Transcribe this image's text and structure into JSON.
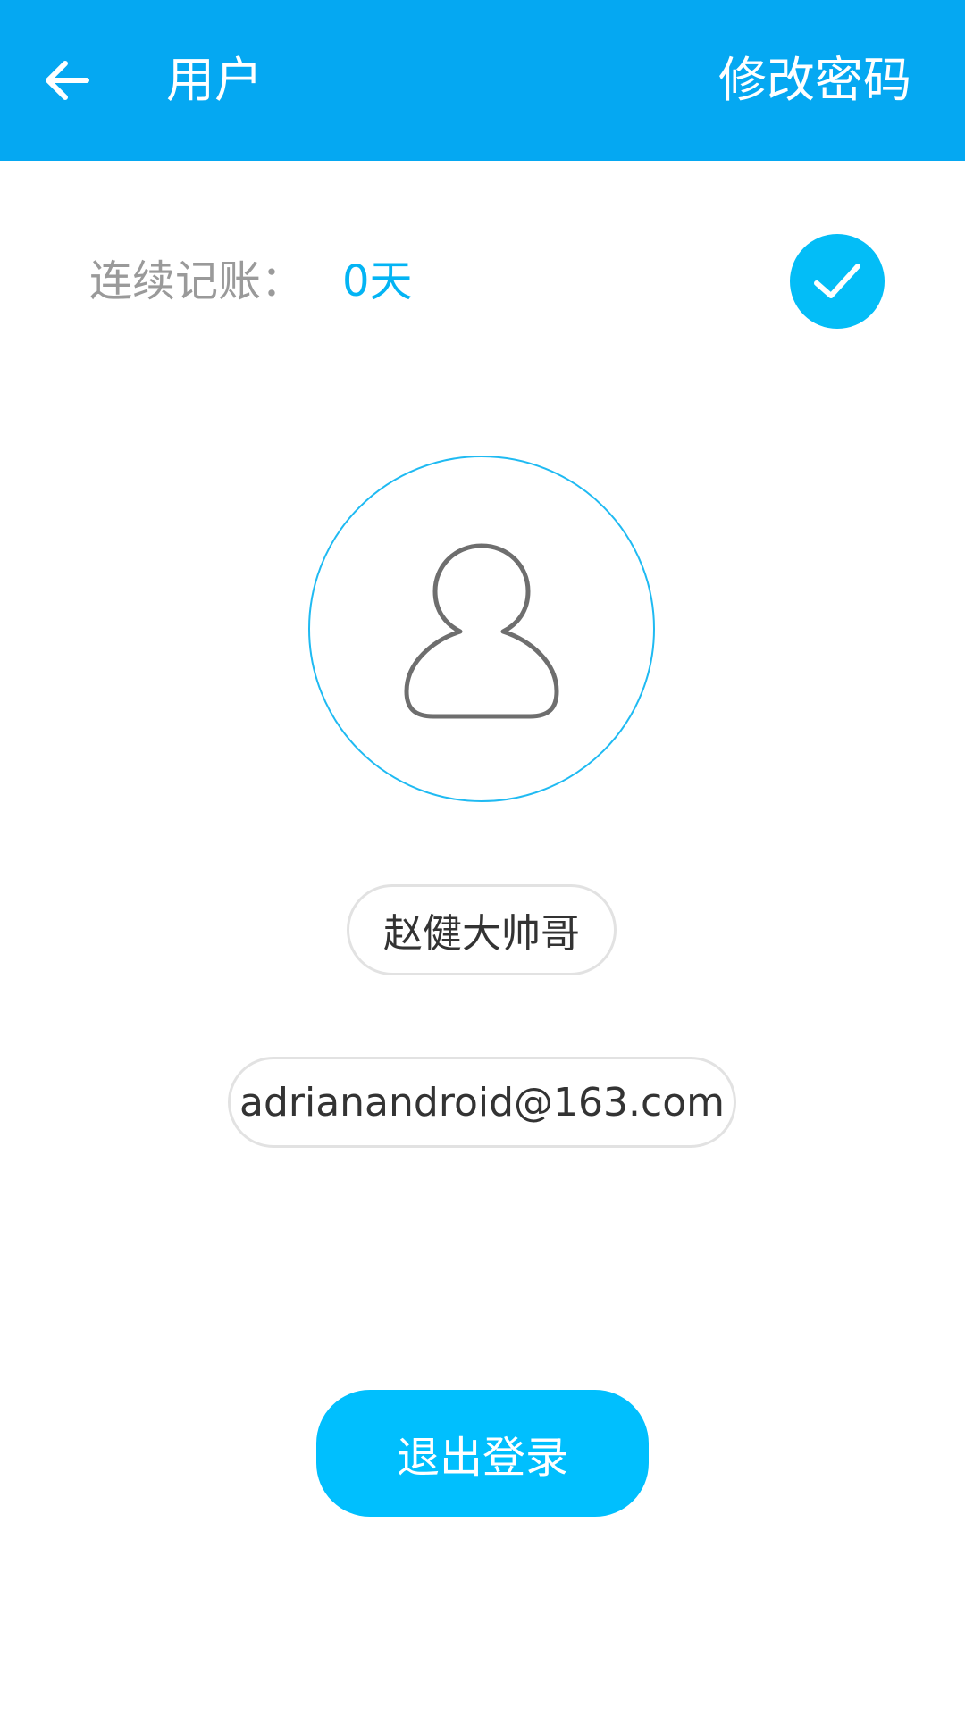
{
  "app_bar": {
    "back_icon": "arrow-left-icon",
    "title": "用户",
    "action_label": "修改密码",
    "background": "#05a8f2"
  },
  "streak": {
    "label": "连续记账：",
    "value": "0天",
    "value_color": "#03b4f4",
    "checkin_icon": "check-icon",
    "checkin_color": "#03bdf7"
  },
  "profile": {
    "avatar_icon": "user-avatar-icon",
    "username": "赵健大帅哥",
    "email": "adrianandroid@163.com"
  },
  "logout": {
    "label": "退出登录",
    "color": "#00bffe"
  }
}
